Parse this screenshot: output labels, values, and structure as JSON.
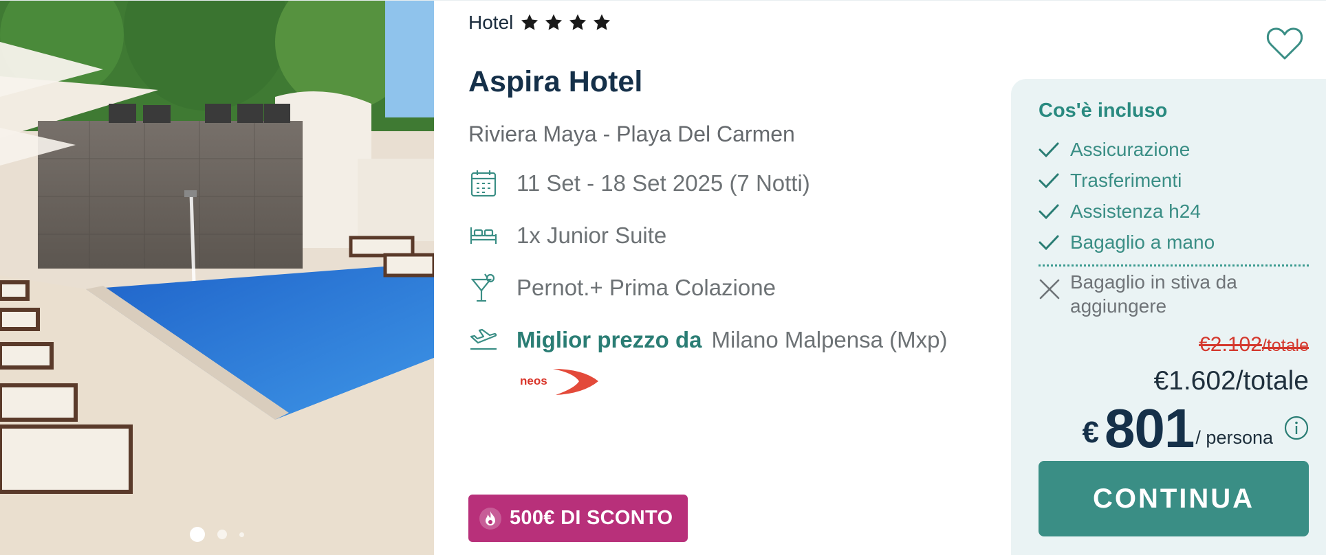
{
  "hotel": {
    "category_label": "Hotel",
    "stars": 4,
    "name": "Aspira Hotel",
    "location": "Riviera Maya - Playa Del Carmen",
    "dates": "11 Set - 18 Set 2025 (7 Notti)",
    "room": "1x Junior Suite",
    "board": "Pernot.+ Prima Colazione",
    "best_price_label": "Miglior prezzo da",
    "departure": "Milano Malpensa (Mxp)",
    "airline_logo_text": "neos"
  },
  "gallery": {
    "slide_count": 3,
    "active_slide": 1
  },
  "promo": {
    "discount_label": "500€ DI SCONTO"
  },
  "panel": {
    "title": "Cos'è incluso",
    "included": [
      "Assicurazione",
      "Trasferimenti",
      "Assistenza h24",
      "Bagaglio a mano"
    ],
    "excluded": [
      "Bagaglio in stiva da aggiungere"
    ],
    "old_price": "€2.102",
    "old_price_suffix": "/totale",
    "total_price": "€1.602/totale",
    "pp_currency": "€",
    "pp_amount": "801",
    "pp_unit": "/ persona",
    "cta_label": "CONTINUA"
  },
  "icons": {
    "stars": "star-icon",
    "dates": "calendar-icon",
    "room": "bed-icon",
    "board": "cocktail-icon",
    "flight": "plane-icon",
    "favorite": "heart-icon",
    "included": "check-icon",
    "excluded": "cross-icon",
    "info": "info-icon",
    "discount": "flame-icon"
  },
  "colors": {
    "title": "#153049",
    "accent": "#3a8e85",
    "discount_bg": "#b8307a",
    "old_price": "#d4382d",
    "panel_bg": "#eaf3f4"
  }
}
